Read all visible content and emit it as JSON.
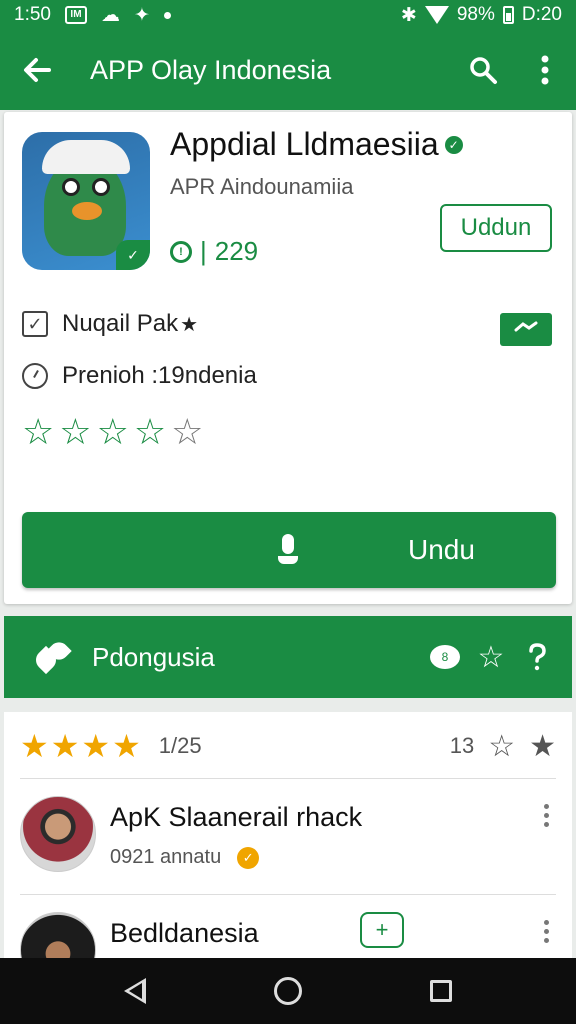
{
  "status_bar": {
    "time": "1:50",
    "battery_percent": "98%",
    "clock_right": "D:20"
  },
  "app_bar": {
    "title": "APP Olay Indonesia"
  },
  "app_card": {
    "name": "Appdial Lldmaesiia",
    "developer": "APR Aindounamiia",
    "count": "229",
    "count_icon": "!",
    "outline_button": "Uddun",
    "row1_label": "Nuqail Pak",
    "row2_label": "Prenioh :19ndenia",
    "green_tag_icon": "arrow-icon",
    "rating_stars": 4,
    "rating_max": 5,
    "main_button": "Undu"
  },
  "section": {
    "title": "Pdongusia",
    "chat_glyph": "8"
  },
  "reviews": {
    "header_score": "1/25",
    "header_count": "13",
    "items": [
      {
        "name": "ApK Slaanerail rhack",
        "subtitle": "0921 annatu"
      },
      {
        "name": "Bedldanesia",
        "subtitle": ""
      }
    ]
  },
  "colors": {
    "brand_green": "#1a8c43",
    "star_gold": "#f0a500"
  }
}
